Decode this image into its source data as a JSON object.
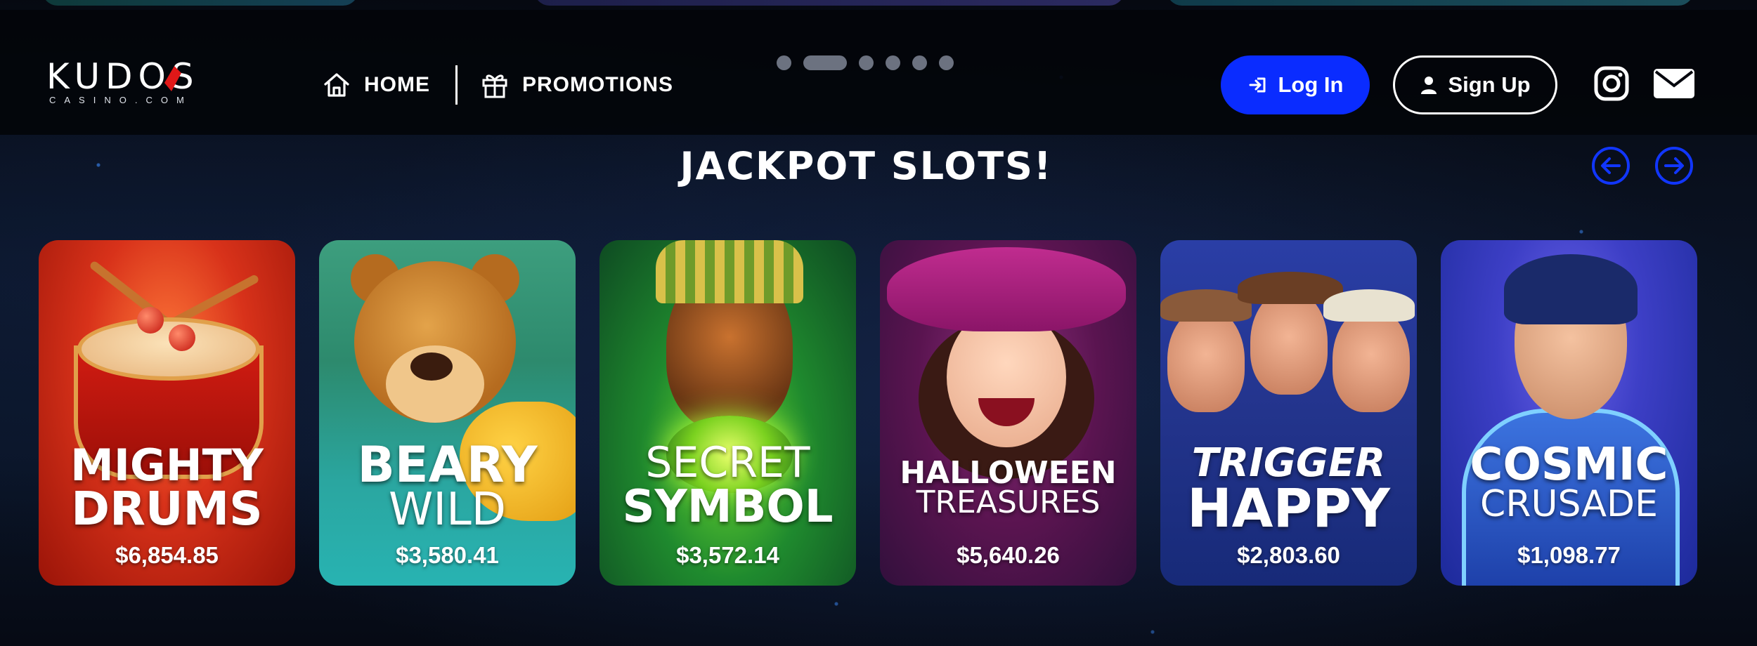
{
  "brand": {
    "logo_text": "KUDOS",
    "logo_subtext": "CASINO.COM"
  },
  "nav": {
    "home_label": "HOME",
    "promotions_label": "PROMOTIONS"
  },
  "carousel": {
    "dot_count": 6,
    "active_index": 1
  },
  "auth": {
    "login_label": "Log In",
    "signup_label": "Sign Up"
  },
  "social": [
    "instagram-icon",
    "mail-icon"
  ],
  "section": {
    "title": "JACKPOT SLOTS!"
  },
  "games": [
    {
      "title_line1": "MIGHTY",
      "title_line2": "DRUMS",
      "jackpot": "$6,854.85"
    },
    {
      "title_line1": "BEARY",
      "title_line2": "WILD",
      "jackpot": "$3,580.41"
    },
    {
      "title_line1": "SECRET",
      "title_line2": "SYMBOL",
      "jackpot": "$3,572.14"
    },
    {
      "title_line1": "HALLOWEEN",
      "title_line2": "TREASURES",
      "jackpot": "$5,640.26"
    },
    {
      "title_line1": "TRIGGER",
      "title_line2": "HAPPY",
      "jackpot": "$2,803.60"
    },
    {
      "title_line1": "COSMIC",
      "title_line2": "CRUSADE",
      "jackpot": "$1,098.77"
    }
  ],
  "colors": {
    "primary_blue": "#0a2cff",
    "arrow_blue": "#1136ff",
    "background": "#05070d"
  }
}
